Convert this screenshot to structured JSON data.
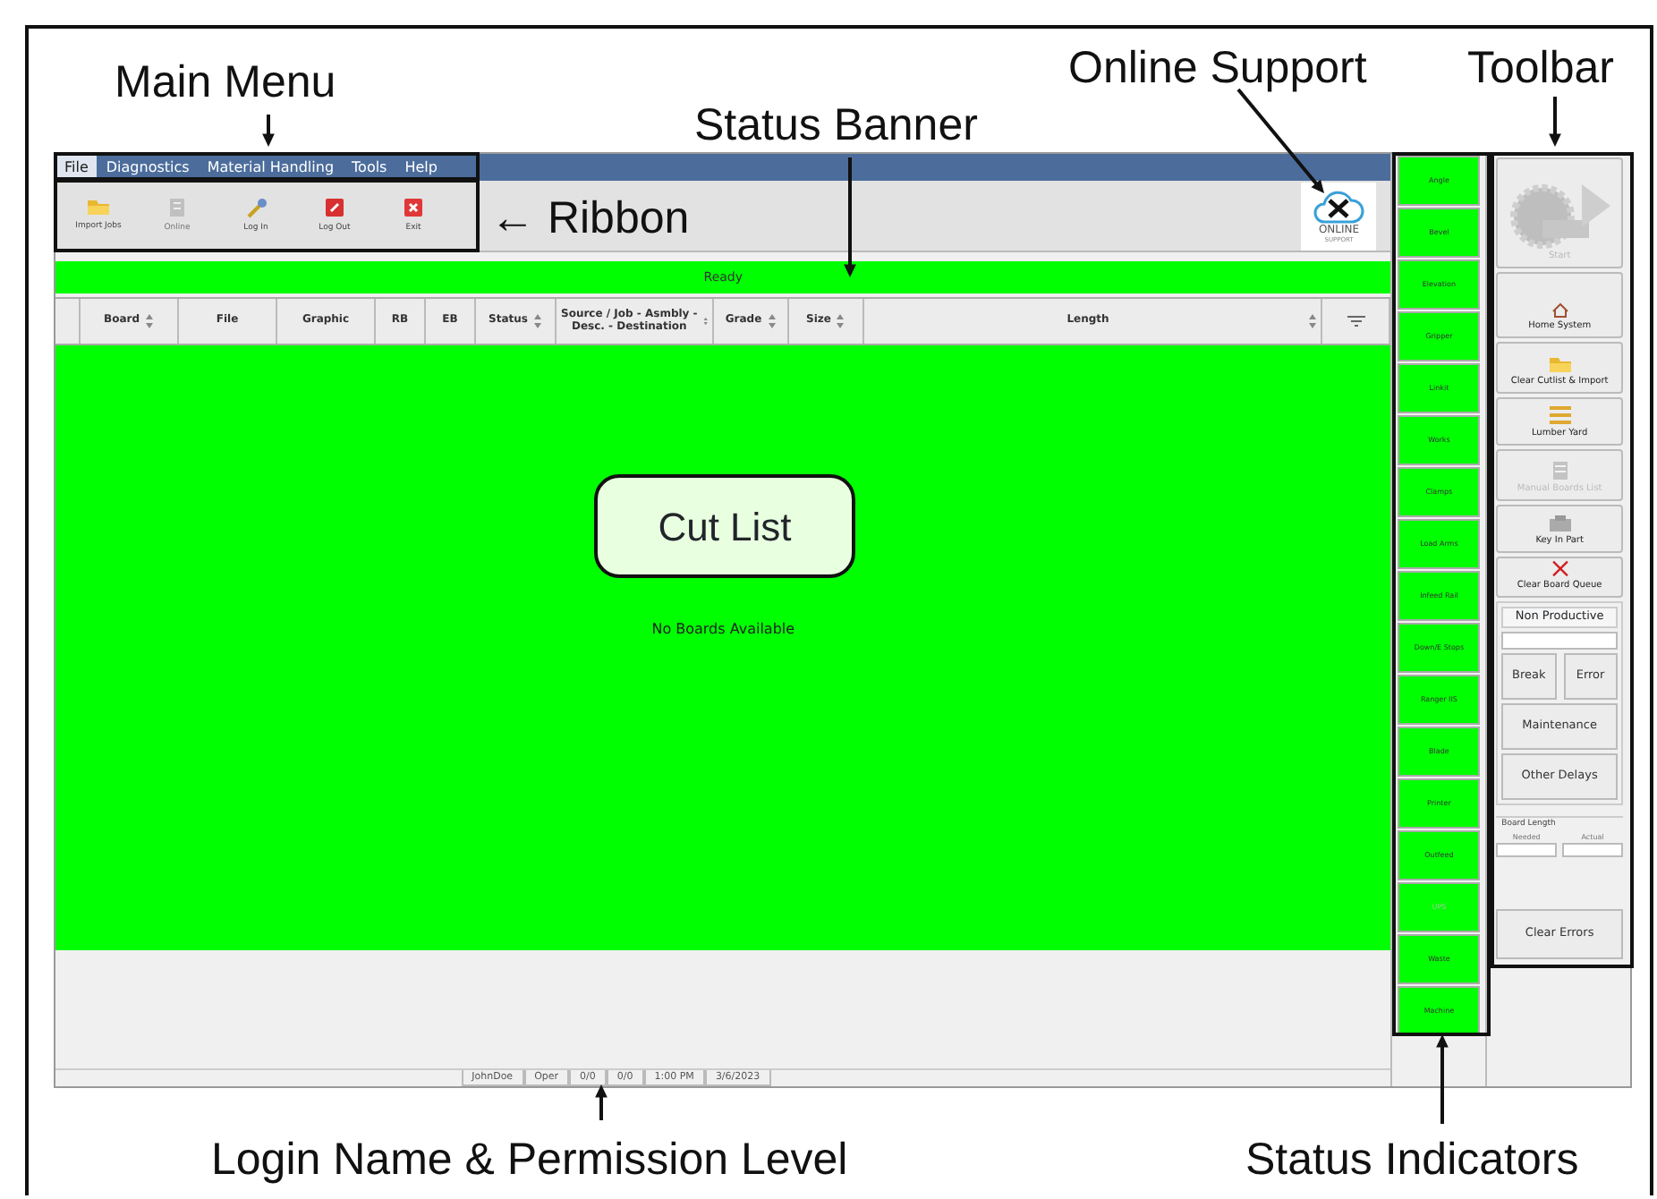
{
  "annotations": [
    {
      "text": "Main Menu"
    },
    {
      "text": "Status Banner"
    },
    {
      "text": "Online Support"
    },
    {
      "text": "Toolbar"
    },
    {
      "text": "← Ribbon"
    },
    {
      "text": "Cut List"
    },
    {
      "text": "Login Name & Permission Level"
    },
    {
      "text": "Status Indicators"
    }
  ],
  "menu": [
    {
      "label": "File",
      "selected": true
    },
    {
      "label": "Diagnostics",
      "selected": false
    },
    {
      "label": "Material Handling",
      "selected": false
    },
    {
      "label": "Tools",
      "selected": false
    },
    {
      "label": "Help",
      "selected": false
    }
  ],
  "ribbon": [
    {
      "label": "Import Jobs",
      "disabled": false,
      "kind": "folder"
    },
    {
      "label": "Online",
      "disabled": true,
      "kind": "doc"
    },
    {
      "label": "Log In",
      "disabled": false,
      "kind": "key"
    },
    {
      "label": "Log Out",
      "disabled": false,
      "kind": "logout"
    },
    {
      "label": "Exit",
      "disabled": false,
      "kind": "exit"
    }
  ],
  "online_support": {
    "title": "ONLINE",
    "subtitle": "SUPPORT"
  },
  "status_banner": {
    "text": "Ready"
  },
  "table": {
    "columns": [
      {
        "label": "Board",
        "sortable": true
      },
      {
        "label": "File",
        "sortable": false
      },
      {
        "label": "Graphic",
        "sortable": false
      },
      {
        "label": "RB",
        "sortable": false
      },
      {
        "label": "EB",
        "sortable": false
      },
      {
        "label": "Status",
        "sortable": true
      },
      {
        "label": "Source / Job - Asmbly - Desc. - Destination",
        "sortable": true
      },
      {
        "label": "Grade",
        "sortable": true
      },
      {
        "label": "Size",
        "sortable": true
      },
      {
        "label": "Length",
        "sortable": true
      }
    ],
    "empty_message": "No Boards Available"
  },
  "status_bar": [
    "JohnDoe",
    "Oper",
    "0/0",
    "0/0",
    "1:00 PM",
    "3/6/2023"
  ],
  "indicators": [
    {
      "label": "Angle",
      "disabled": false
    },
    {
      "label": "Bevel",
      "disabled": false
    },
    {
      "label": "Elevation",
      "disabled": false
    },
    {
      "label": "Gripper",
      "disabled": false
    },
    {
      "label": "Linkit",
      "disabled": false
    },
    {
      "label": "Works",
      "disabled": false
    },
    {
      "label": "Clamps",
      "disabled": false
    },
    {
      "label": "Load Arms",
      "disabled": false
    },
    {
      "label": "Infeed Rail",
      "disabled": false
    },
    {
      "label": "Down/E Stops",
      "disabled": false
    },
    {
      "label": "Ranger IIS",
      "disabled": false
    },
    {
      "label": "Blade",
      "disabled": false
    },
    {
      "label": "Printer",
      "disabled": false
    },
    {
      "label": "Outfeed",
      "disabled": false
    },
    {
      "label": "UPS",
      "disabled": true
    },
    {
      "label": "Waste",
      "disabled": false
    },
    {
      "label": "Machine",
      "disabled": false
    }
  ],
  "toolbar": [
    {
      "label": "Start",
      "disabled": true,
      "kind": "saw"
    },
    {
      "label": "Home System",
      "disabled": false,
      "kind": "home"
    },
    {
      "label": "Clear Cutlist & Import",
      "disabled": false,
      "kind": "folder"
    },
    {
      "label": "Lumber Yard",
      "disabled": false,
      "kind": "lumber"
    },
    {
      "label": "Manual Boards List",
      "disabled": true,
      "kind": "list"
    },
    {
      "label": "Key In Part",
      "disabled": false,
      "kind": "keyboard"
    },
    {
      "label": "Clear Board Queue",
      "disabled": false,
      "kind": "x"
    }
  ],
  "delays": {
    "title": "Non Productive",
    "buttons": [
      "Break",
      "Error",
      "Maintenance",
      "Other Delays"
    ]
  },
  "board_length": {
    "title": "Board Length",
    "fields": [
      "Needed",
      "Actual"
    ]
  },
  "clear_errors": "Clear Errors"
}
